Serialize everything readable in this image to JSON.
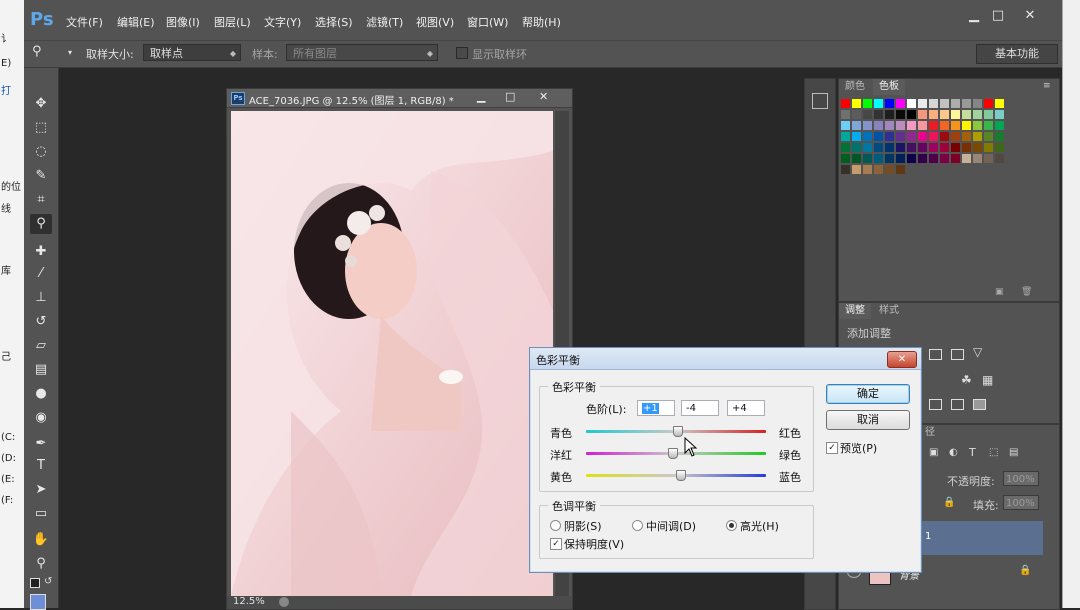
{
  "background_window": {
    "texts": [
      "讠",
      "E)",
      "打",
      "的位",
      "线",
      "库",
      "己",
      "(C:",
      "(D:",
      "(E:",
      "(F:"
    ]
  },
  "menubar": {
    "logo": "Ps",
    "items": [
      "文件(F)",
      "编辑(E)",
      "图像(I)",
      "图层(L)",
      "文字(Y)",
      "选择(S)",
      "滤镜(T)",
      "视图(V)",
      "窗口(W)",
      "帮助(H)"
    ],
    "window_controls": [
      "▁",
      "□",
      "✕"
    ]
  },
  "optionsbar": {
    "sample_size_label": "取样大小:",
    "sample_size_value": "取样点",
    "sample_label": "样本:",
    "sample_value": "所有图层",
    "show_ring_label": "显示取样环",
    "workspace": "基本功能"
  },
  "document": {
    "title": "ACE_7036.JPG @ 12.5% (图层 1, RGB/8) *",
    "icon_text": "Ps",
    "controls": [
      "▁",
      "□",
      "✕"
    ],
    "zoom": "12.5%"
  },
  "swatches_panel": {
    "tabs": [
      "颜色",
      "色板"
    ],
    "colors": [
      "#ff0000",
      "#ffff00",
      "#00ff00",
      "#00ffff",
      "#0000ff",
      "#ff00ff",
      "#ffffff",
      "#ebebeb",
      "#d6d6d6",
      "#c2c2c2",
      "#adadad",
      "#999999",
      "#858585",
      "#ff0000",
      "#ffff00",
      "#707070",
      "#5c5c5c",
      "#474747",
      "#333333",
      "#1f1f1f",
      "#0a0a0a",
      "#000000",
      "#f7977a",
      "#f9ad81",
      "#fdc68a",
      "#fff79a",
      "#c4df9b",
      "#a3d39c",
      "#82ca9d",
      "#7bcdc8",
      "#6ecff6",
      "#7ea7d8",
      "#8493ca",
      "#8882be",
      "#a187be",
      "#bc8dbf",
      "#f49ac2",
      "#f6989d",
      "#ed1c24",
      "#f26522",
      "#f7941d",
      "#fff200",
      "#8dc73f",
      "#39b54a",
      "#00a651",
      "#00a99d",
      "#00aeef",
      "#0072bc",
      "#0054a6",
      "#2e3192",
      "#662d91",
      "#92278f",
      "#ec008c",
      "#ed145b",
      "#9e0b0f",
      "#a0410d",
      "#a36209",
      "#aba000",
      "#598527",
      "#197b30",
      "#007236",
      "#00746b",
      "#0076a3",
      "#004b80",
      "#003471",
      "#1b1464",
      "#440e62",
      "#630460",
      "#9e005d",
      "#9e0039",
      "#790000",
      "#7b2e00",
      "#7d4900",
      "#827b00",
      "#406618",
      "#005e20",
      "#005826",
      "#005952",
      "#005b7f",
      "#003663",
      "#002157",
      "#0d004c",
      "#32004b",
      "#4b0049",
      "#7b0046",
      "#7a0026",
      "#c7b299",
      "#998675",
      "#736357",
      "#534741",
      "#37302a",
      "#c69c6d",
      "#a67c52",
      "#8c6239",
      "#754c24",
      "#603913"
    ]
  },
  "adjustments_panel": {
    "tabs": [
      "调整",
      "样式"
    ],
    "hint": "添加调整"
  },
  "layers_panel": {
    "tab_fragment": "径",
    "opacity_label": "不透明度:",
    "opacity_value": "100%",
    "fill_label": "填充:",
    "fill_value": "100%",
    "layer1_name_fragment": "1",
    "bg_layer_name": "背景"
  },
  "dialog": {
    "title": "色彩平衡",
    "group1_label": "色彩平衡",
    "levels_label": "色阶(L):",
    "levels": [
      "+1",
      "-4",
      "+4"
    ],
    "rows": [
      {
        "left": "青色",
        "right": "红色",
        "value": 1
      },
      {
        "left": "洋红",
        "right": "绿色",
        "value": -4
      },
      {
        "left": "黄色",
        "right": "蓝色",
        "value": 4
      }
    ],
    "group2_label": "色调平衡",
    "tones": [
      "阴影(S)",
      "中间调(D)",
      "高光(H)"
    ],
    "selected_tone": "高光(H)",
    "preserve_luminosity": "保持明度(V)",
    "preserve_checked": true,
    "ok": "确定",
    "cancel": "取消",
    "preview": "预览(P)",
    "preview_checked": true
  }
}
